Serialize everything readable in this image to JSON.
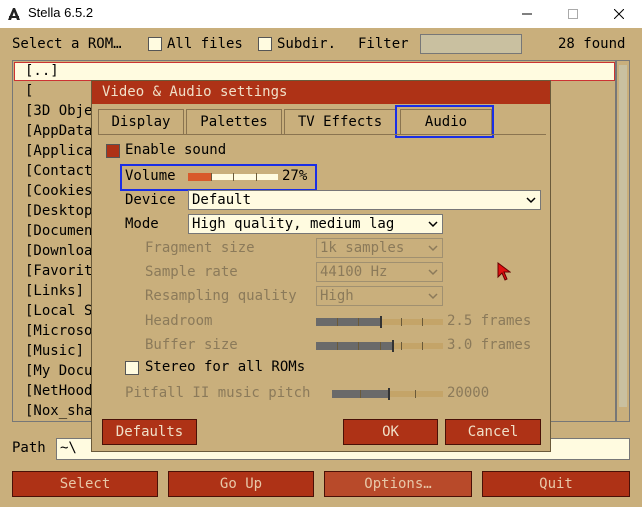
{
  "window": {
    "title": "Stella 6.5.2"
  },
  "launcher": {
    "select_rom_label": "Select a ROM…",
    "all_files_label": "All files",
    "subdir_label": "Subdir.",
    "filter_label": "Filter",
    "found_count": "28 found",
    "files": [
      "[..]",
      "[",
      "[3D Obje",
      "[AppData",
      "[Applica",
      "[Contact",
      "[Cookies",
      "[Desktop",
      "[Documen",
      "[Downloa",
      "[Favorit",
      "[Links]",
      "[Local S",
      "[Microso",
      "[Music]",
      "[My Docu",
      "[NetHood",
      "[Nox_sha"
    ],
    "path_label": "Path",
    "path_value": "~\\",
    "buttons": {
      "select": "Select",
      "go_up": "Go Up",
      "options": "Options…",
      "quit": "Quit"
    }
  },
  "dialog": {
    "title": "Video & Audio settings",
    "tabs": [
      "Display",
      "Palettes",
      "TV Effects",
      "Audio"
    ],
    "active_tab": "Audio",
    "enable_sound_label": "Enable sound",
    "enable_sound_checked": true,
    "volume_label": "Volume",
    "volume_value": "27%",
    "volume_level": 0.27,
    "device_label": "Device",
    "device_value": "Default",
    "mode_label": "Mode",
    "mode_value": "High quality, medium lag",
    "fragment_size_label": "Fragment size",
    "fragment_size_value": "1k samples",
    "sample_rate_label": "Sample rate",
    "sample_rate_value": "44100 Hz",
    "resampling_label": "Resampling quality",
    "resampling_value": "High",
    "headroom_label": "Headroom",
    "headroom_value": "2.5 frames",
    "headroom_level": 0.5,
    "buffer_label": "Buffer size",
    "buffer_value": "3.0 frames",
    "buffer_level": 0.6,
    "stereo_label": "Stereo for all ROMs",
    "stereo_checked": false,
    "pitfall_label": "Pitfall II music pitch",
    "pitfall_value": "20000",
    "pitfall_level": 0.5,
    "buttons": {
      "defaults": "Defaults",
      "ok": "OK",
      "cancel": "Cancel"
    }
  },
  "colors": {
    "background": "#c9af7c",
    "accent_red": "#ae3216",
    "highlight_blue": "#1a2ee6",
    "slider_fill": "#d85a2b"
  }
}
